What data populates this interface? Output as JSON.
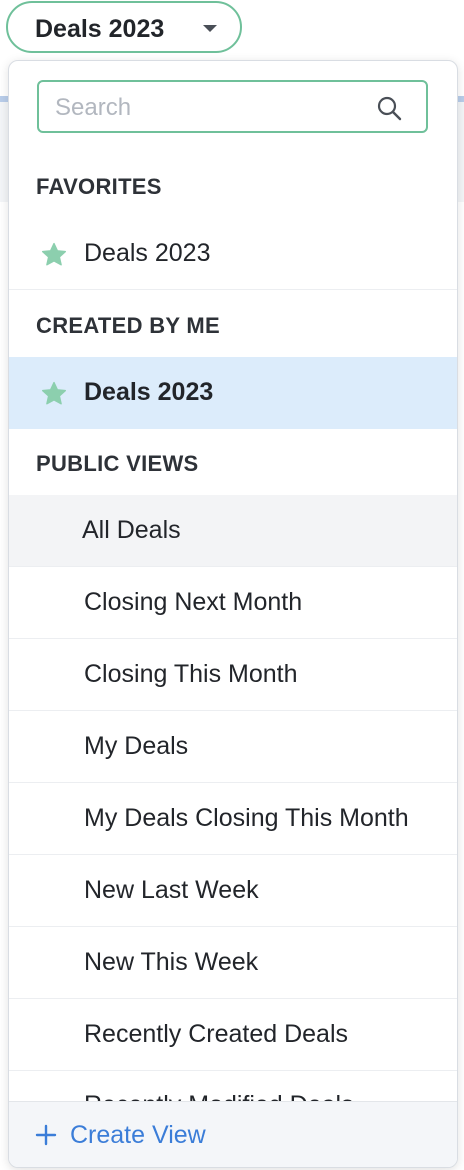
{
  "view_selector": {
    "label": "Deals 2023",
    "icon": "caret-down-icon"
  },
  "search": {
    "placeholder": "Search",
    "value": ""
  },
  "sections": {
    "favorites": {
      "title": "FAVORITES",
      "items": [
        {
          "label": "Deals 2023",
          "starred": true
        }
      ]
    },
    "created_by_me": {
      "title": "CREATED BY ME",
      "items": [
        {
          "label": "Deals 2023",
          "starred": true,
          "selected": true
        }
      ]
    },
    "public_views": {
      "title": "PUBLIC VIEWS",
      "items": [
        {
          "label": "All Deals"
        },
        {
          "label": "Closing Next Month"
        },
        {
          "label": "Closing This Month"
        },
        {
          "label": "My Deals"
        },
        {
          "label": "My Deals Closing This Month"
        },
        {
          "label": "New Last Week"
        },
        {
          "label": "New This Week"
        },
        {
          "label": "Recently Created Deals"
        },
        {
          "label": "Recently Modified Deals"
        }
      ]
    }
  },
  "footer": {
    "create_label": "Create View"
  },
  "colors": {
    "accent_green": "#6fc09a",
    "star": "#8ccfae",
    "selected_bg": "#dcecfb",
    "link_blue": "#3b7dd8"
  }
}
